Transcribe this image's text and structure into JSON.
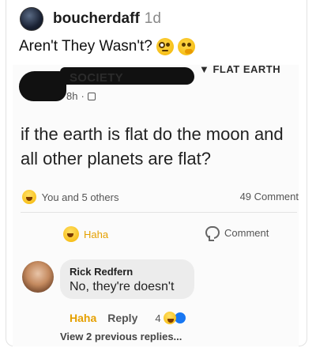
{
  "post": {
    "author": "boucherdaff",
    "time": "1d",
    "caption": "Aren't They Wasn't?",
    "caption_emojis": [
      "monocle-face",
      "thinking-face"
    ]
  },
  "screenshot": {
    "page_name": "SOCIETY",
    "page_tag": "▼ FLAT EARTH",
    "meta_time": "8h",
    "meta_separator": "·",
    "body": "if the earth is flat do the moon and all other planets are flat?",
    "reactions_text": "You and 5 others",
    "comment_count": "49 Comment",
    "actions": {
      "haha": "Haha",
      "comment": "Comment"
    },
    "comment": {
      "author": "Rick Redfern",
      "text": "No, they're doesn't",
      "haha": "Haha",
      "reply": "Reply",
      "reaction_count": "4"
    },
    "view_previous": "View 2 previous replies..."
  },
  "colors": {
    "haha": "#e5a000",
    "like": "#1877f2"
  }
}
